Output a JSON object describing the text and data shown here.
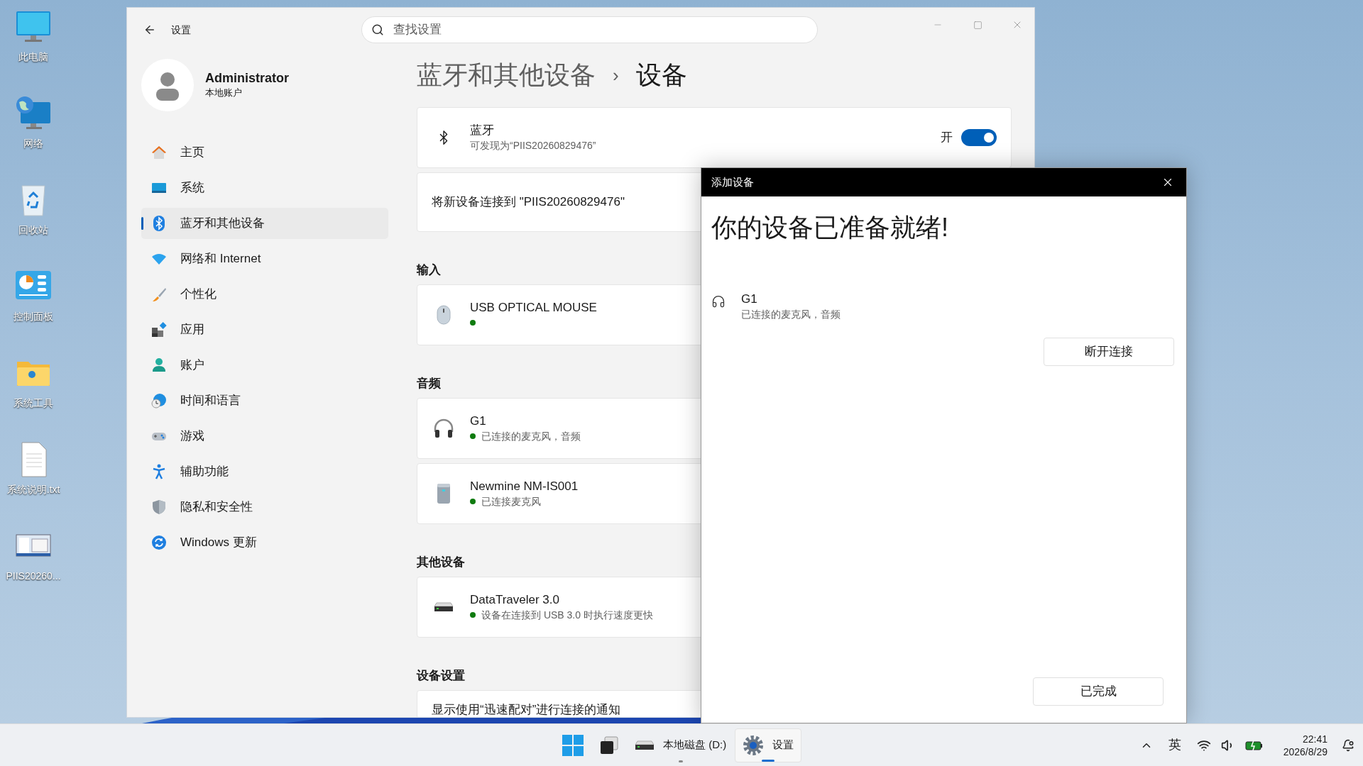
{
  "desktop": {
    "icons": [
      {
        "label": "此电脑"
      },
      {
        "label": "网络"
      },
      {
        "label": "回收站"
      },
      {
        "label": "控制面板"
      },
      {
        "label": "系统工具"
      },
      {
        "label": "系统说明.txt"
      },
      {
        "label": "PIIS20260..."
      }
    ]
  },
  "settings": {
    "title": "设置",
    "search": {
      "placeholder": "查找设置"
    },
    "profile": {
      "name": "Administrator",
      "account": "本地账户"
    },
    "nav": [
      {
        "label": "主页",
        "selected": false
      },
      {
        "label": "系统",
        "selected": false
      },
      {
        "label": "蓝牙和其他设备",
        "selected": true
      },
      {
        "label": "网络和 Internet",
        "selected": false
      },
      {
        "label": "个性化",
        "selected": false
      },
      {
        "label": "应用",
        "selected": false
      },
      {
        "label": "账户",
        "selected": false
      },
      {
        "label": "时间和语言",
        "selected": false
      },
      {
        "label": "游戏",
        "selected": false
      },
      {
        "label": "辅助功能",
        "selected": false
      },
      {
        "label": "隐私和安全性",
        "selected": false
      },
      {
        "label": "Windows 更新",
        "selected": false
      }
    ],
    "breadcrumb": {
      "parent": "蓝牙和其他设备",
      "separator": "›",
      "current": "设备"
    },
    "bluetooth": {
      "title": "蓝牙",
      "subtitle": "可发现为“PIIS20260829476”",
      "state_label": "开",
      "on": true
    },
    "pair_card": {
      "text": "将新设备连接到 \"PIIS20260829476\""
    },
    "sections": [
      {
        "title": "输入",
        "devices": [
          {
            "kind": "mouse",
            "name": "USB OPTICAL MOUSE",
            "connected": true
          }
        ]
      },
      {
        "title": "音频",
        "devices": [
          {
            "kind": "headphones",
            "name": "G1",
            "status": "已连接的麦克风，音频",
            "connected": true
          },
          {
            "kind": "speaker",
            "name": "Newmine NM-IS001",
            "status": "已连接麦克风",
            "connected": true
          }
        ]
      },
      {
        "title": "其他设备",
        "devices": [
          {
            "kind": "drive",
            "name": "DataTraveler 3.0",
            "status": "设备在连接到 USB 3.0 时执行速度更快",
            "connected": true
          }
        ]
      },
      {
        "title": "设备设置",
        "cards": [
          {
            "text": "显示使用“迅速配对”进行连接的通知"
          }
        ]
      }
    ]
  },
  "dialog": {
    "title": "添加设备",
    "heading": "你的设备已准备就绪!",
    "device": {
      "name": "G1",
      "status": "已连接的麦克风，音频"
    },
    "disconnect_button": "断开连接",
    "done_button": "已完成"
  },
  "taskbar": {
    "apps": [
      {
        "kind": "start",
        "running": false,
        "selected": false
      },
      {
        "kind": "taskview",
        "running": false,
        "selected": false
      },
      {
        "kind": "drive",
        "label": "本地磁盘 (D:)",
        "running": true,
        "selected": false
      },
      {
        "kind": "settings",
        "label": "设置",
        "running": true,
        "selected": true
      }
    ],
    "ime": "英",
    "time": "22:41",
    "date": "2026/8/29"
  }
}
